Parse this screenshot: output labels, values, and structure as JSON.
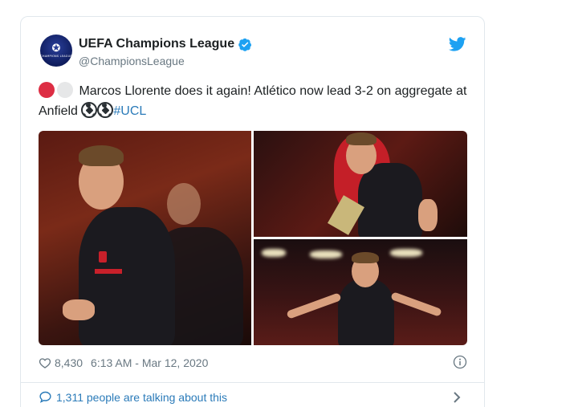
{
  "author": {
    "name": "UEFA Champions League",
    "handle": "@ChampionsLeague",
    "avatar_text": "CHAMPIONS LEAGUE"
  },
  "tweet": {
    "text_main": "Marcos Llorente does it again! Atlético now lead 3-2 on aggregate at Anfield ",
    "hashtag": "#UCL",
    "emoji_names": [
      "red-circle",
      "white-circle",
      "soccer-ball",
      "soccer-ball"
    ]
  },
  "media": {
    "photos": [
      {
        "description_icon": "player-celebrating"
      },
      {
        "description_icon": "players-hugging"
      },
      {
        "description_icon": "player-arms-outstretched"
      }
    ]
  },
  "meta": {
    "likes": "8,430",
    "timestamp": "6:13 AM - Mar 12, 2020"
  },
  "footer": {
    "talking": "1,311 people are talking about this"
  },
  "colors": {
    "link": "#2b7bb9",
    "muted": "#697882",
    "border": "#e1e8ed",
    "twitter_blue": "#1da1f2"
  }
}
